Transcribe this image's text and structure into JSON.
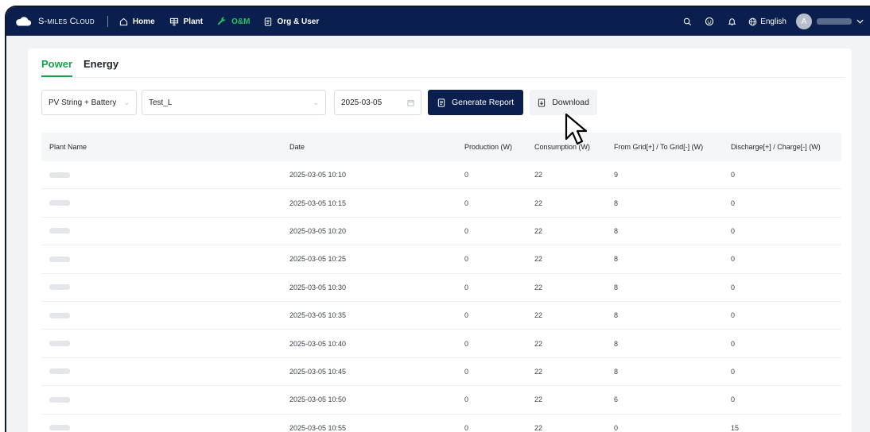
{
  "brand": {
    "name": "S-miles Cloud"
  },
  "nav": {
    "items": [
      {
        "label": "Home",
        "icon": "home-icon"
      },
      {
        "label": "Plant",
        "icon": "plant-icon"
      },
      {
        "label": "O&M",
        "icon": "wrench-icon",
        "active": true
      },
      {
        "label": "Org & User",
        "icon": "document-icon"
      }
    ],
    "language": "English",
    "avatar_initial": "A"
  },
  "tabs": [
    {
      "label": "Power",
      "active": true
    },
    {
      "label": "Energy",
      "active": false
    }
  ],
  "filters": {
    "device_type": "PV String + Battery",
    "plant": "Test_L",
    "date": "2025-03-05"
  },
  "buttons": {
    "generate_report": "Generate Report",
    "download": "Download"
  },
  "table": {
    "headers": [
      "Plant Name",
      "Date",
      "Production (W)",
      "Consumption (W)",
      "From Grid[+] / To Grid[-] (W)",
      "Discharge[+] / Charge[-] (W)"
    ],
    "rows": [
      {
        "date": "2025-03-05 10:10",
        "production": "0",
        "consumption": "22",
        "grid": "9",
        "battery": "0"
      },
      {
        "date": "2025-03-05 10:15",
        "production": "0",
        "consumption": "22",
        "grid": "8",
        "battery": "0"
      },
      {
        "date": "2025-03-05 10:20",
        "production": "0",
        "consumption": "22",
        "grid": "8",
        "battery": "0"
      },
      {
        "date": "2025-03-05 10:25",
        "production": "0",
        "consumption": "22",
        "grid": "8",
        "battery": "0"
      },
      {
        "date": "2025-03-05 10:30",
        "production": "0",
        "consumption": "22",
        "grid": "8",
        "battery": "0"
      },
      {
        "date": "2025-03-05 10:35",
        "production": "0",
        "consumption": "22",
        "grid": "8",
        "battery": "0"
      },
      {
        "date": "2025-03-05 10:40",
        "production": "0",
        "consumption": "22",
        "grid": "8",
        "battery": "0"
      },
      {
        "date": "2025-03-05 10:45",
        "production": "0",
        "consumption": "22",
        "grid": "8",
        "battery": "0"
      },
      {
        "date": "2025-03-05 10:50",
        "production": "0",
        "consumption": "22",
        "grid": "6",
        "battery": "0"
      },
      {
        "date": "2025-03-05 10:55",
        "production": "0",
        "consumption": "22",
        "grid": "0",
        "battery": "15"
      }
    ]
  },
  "colors": {
    "nav_bg": "#0a1f4d",
    "accent": "#16a34a",
    "active_nav": "#22c55e"
  }
}
